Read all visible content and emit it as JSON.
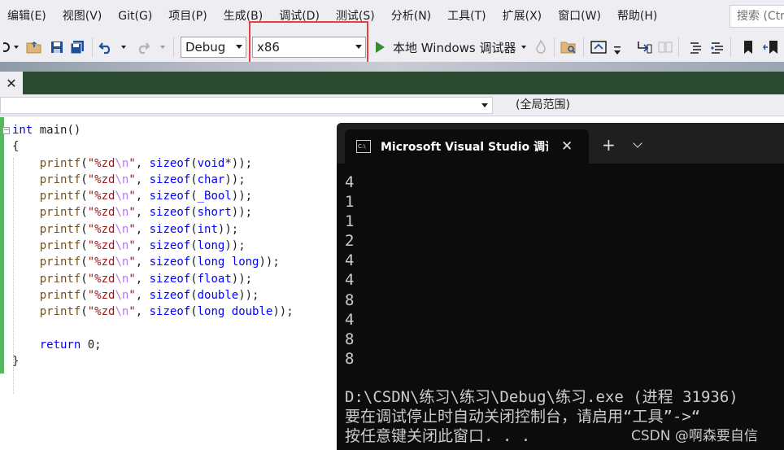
{
  "menu": {
    "items": [
      "编辑(E)",
      "视图(V)",
      "Git(G)",
      "项目(P)",
      "生成(B)",
      "调试(D)",
      "测试(S)",
      "分析(N)",
      "工具(T)",
      "扩展(X)",
      "窗口(W)",
      "帮助(H)"
    ],
    "search_placeholder": "搜索 (Ctrl"
  },
  "toolbar": {
    "configuration": "Debug",
    "platform": "x86",
    "debugger_label": "本地 Windows 调试器"
  },
  "navbar": {
    "scope": "(全局范围)"
  },
  "editor": {
    "lines": [
      [
        {
          "t": "int",
          "c": "kw"
        },
        {
          "t": " main()",
          "c": ""
        }
      ],
      [
        {
          "t": "{",
          "c": ""
        }
      ],
      [
        {
          "t": "    ",
          "c": ""
        },
        {
          "t": "printf",
          "c": "fn"
        },
        {
          "t": "(",
          "c": ""
        },
        {
          "t": "\"%zd",
          "c": "str"
        },
        {
          "t": "\\n",
          "c": "esc"
        },
        {
          "t": "\"",
          "c": "str"
        },
        {
          "t": ", ",
          "c": ""
        },
        {
          "t": "sizeof",
          "c": "kw"
        },
        {
          "t": "(",
          "c": ""
        },
        {
          "t": "void",
          "c": "kw"
        },
        {
          "t": "*));",
          "c": ""
        }
      ],
      [
        {
          "t": "    ",
          "c": ""
        },
        {
          "t": "printf",
          "c": "fn"
        },
        {
          "t": "(",
          "c": ""
        },
        {
          "t": "\"%zd",
          "c": "str"
        },
        {
          "t": "\\n",
          "c": "esc"
        },
        {
          "t": "\"",
          "c": "str"
        },
        {
          "t": ", ",
          "c": ""
        },
        {
          "t": "sizeof",
          "c": "kw"
        },
        {
          "t": "(",
          "c": ""
        },
        {
          "t": "char",
          "c": "kw"
        },
        {
          "t": "));",
          "c": ""
        }
      ],
      [
        {
          "t": "    ",
          "c": ""
        },
        {
          "t": "printf",
          "c": "fn"
        },
        {
          "t": "(",
          "c": ""
        },
        {
          "t": "\"%zd",
          "c": "str"
        },
        {
          "t": "\\n",
          "c": "esc"
        },
        {
          "t": "\"",
          "c": "str"
        },
        {
          "t": ", ",
          "c": ""
        },
        {
          "t": "sizeof",
          "c": "kw"
        },
        {
          "t": "(",
          "c": ""
        },
        {
          "t": "_Bool",
          "c": "kw"
        },
        {
          "t": "));",
          "c": ""
        }
      ],
      [
        {
          "t": "    ",
          "c": ""
        },
        {
          "t": "printf",
          "c": "fn"
        },
        {
          "t": "(",
          "c": ""
        },
        {
          "t": "\"%zd",
          "c": "str"
        },
        {
          "t": "\\n",
          "c": "esc"
        },
        {
          "t": "\"",
          "c": "str"
        },
        {
          "t": ", ",
          "c": ""
        },
        {
          "t": "sizeof",
          "c": "kw"
        },
        {
          "t": "(",
          "c": ""
        },
        {
          "t": "short",
          "c": "kw"
        },
        {
          "t": "));",
          "c": ""
        }
      ],
      [
        {
          "t": "    ",
          "c": ""
        },
        {
          "t": "printf",
          "c": "fn"
        },
        {
          "t": "(",
          "c": ""
        },
        {
          "t": "\"%zd",
          "c": "str"
        },
        {
          "t": "\\n",
          "c": "esc"
        },
        {
          "t": "\"",
          "c": "str"
        },
        {
          "t": ", ",
          "c": ""
        },
        {
          "t": "sizeof",
          "c": "kw"
        },
        {
          "t": "(",
          "c": ""
        },
        {
          "t": "int",
          "c": "kw"
        },
        {
          "t": "));",
          "c": ""
        }
      ],
      [
        {
          "t": "    ",
          "c": ""
        },
        {
          "t": "printf",
          "c": "fn"
        },
        {
          "t": "(",
          "c": ""
        },
        {
          "t": "\"%zd",
          "c": "str"
        },
        {
          "t": "\\n",
          "c": "esc"
        },
        {
          "t": "\"",
          "c": "str"
        },
        {
          "t": ", ",
          "c": ""
        },
        {
          "t": "sizeof",
          "c": "kw"
        },
        {
          "t": "(",
          "c": ""
        },
        {
          "t": "long",
          "c": "kw"
        },
        {
          "t": "));",
          "c": ""
        }
      ],
      [
        {
          "t": "    ",
          "c": ""
        },
        {
          "t": "printf",
          "c": "fn"
        },
        {
          "t": "(",
          "c": ""
        },
        {
          "t": "\"%zd",
          "c": "str"
        },
        {
          "t": "\\n",
          "c": "esc"
        },
        {
          "t": "\"",
          "c": "str"
        },
        {
          "t": ", ",
          "c": ""
        },
        {
          "t": "sizeof",
          "c": "kw"
        },
        {
          "t": "(",
          "c": ""
        },
        {
          "t": "long long",
          "c": "kw"
        },
        {
          "t": "));",
          "c": ""
        }
      ],
      [
        {
          "t": "    ",
          "c": ""
        },
        {
          "t": "printf",
          "c": "fn"
        },
        {
          "t": "(",
          "c": ""
        },
        {
          "t": "\"%zd",
          "c": "str"
        },
        {
          "t": "\\n",
          "c": "esc"
        },
        {
          "t": "\"",
          "c": "str"
        },
        {
          "t": ", ",
          "c": ""
        },
        {
          "t": "sizeof",
          "c": "kw"
        },
        {
          "t": "(",
          "c": ""
        },
        {
          "t": "float",
          "c": "kw"
        },
        {
          "t": "));",
          "c": ""
        }
      ],
      [
        {
          "t": "    ",
          "c": ""
        },
        {
          "t": "printf",
          "c": "fn"
        },
        {
          "t": "(",
          "c": ""
        },
        {
          "t": "\"%zd",
          "c": "str"
        },
        {
          "t": "\\n",
          "c": "esc"
        },
        {
          "t": "\"",
          "c": "str"
        },
        {
          "t": ", ",
          "c": ""
        },
        {
          "t": "sizeof",
          "c": "kw"
        },
        {
          "t": "(",
          "c": ""
        },
        {
          "t": "double",
          "c": "kw"
        },
        {
          "t": "));",
          "c": ""
        }
      ],
      [
        {
          "t": "    ",
          "c": ""
        },
        {
          "t": "printf",
          "c": "fn"
        },
        {
          "t": "(",
          "c": ""
        },
        {
          "t": "\"%zd",
          "c": "str"
        },
        {
          "t": "\\n",
          "c": "esc"
        },
        {
          "t": "\"",
          "c": "str"
        },
        {
          "t": ", ",
          "c": ""
        },
        {
          "t": "sizeof",
          "c": "kw"
        },
        {
          "t": "(",
          "c": ""
        },
        {
          "t": "long double",
          "c": "kw"
        },
        {
          "t": "));",
          "c": ""
        }
      ],
      [],
      [
        {
          "t": "    ",
          "c": ""
        },
        {
          "t": "return",
          "c": "kw"
        },
        {
          "t": " 0;",
          "c": ""
        }
      ],
      [
        {
          "t": "}",
          "c": ""
        }
      ]
    ]
  },
  "terminal": {
    "tab_title": "Microsoft Visual Studio 调试控制台",
    "tab_icon_text": "C:\\",
    "output": [
      "4",
      "1",
      "1",
      "2",
      "4",
      "4",
      "8",
      "4",
      "8",
      "8"
    ],
    "footer": [
      "D:\\CSDN\\练习\\练习\\Debug\\练习.exe (进程 31936)",
      "要在调试停止时自动关闭控制台，请启用“工具”->“",
      "按任意键关闭此窗口. . ."
    ]
  },
  "watermark": "CSDN @啊森要自信",
  "colors": {
    "highlight_box": "#e8403c",
    "change_bar": "#57b65f",
    "tab_strip": "#2d4a32",
    "play_icon": "#388a34"
  },
  "icons": {
    "tab_close": "✕",
    "new_tab": "+",
    "term_close": "✕"
  }
}
